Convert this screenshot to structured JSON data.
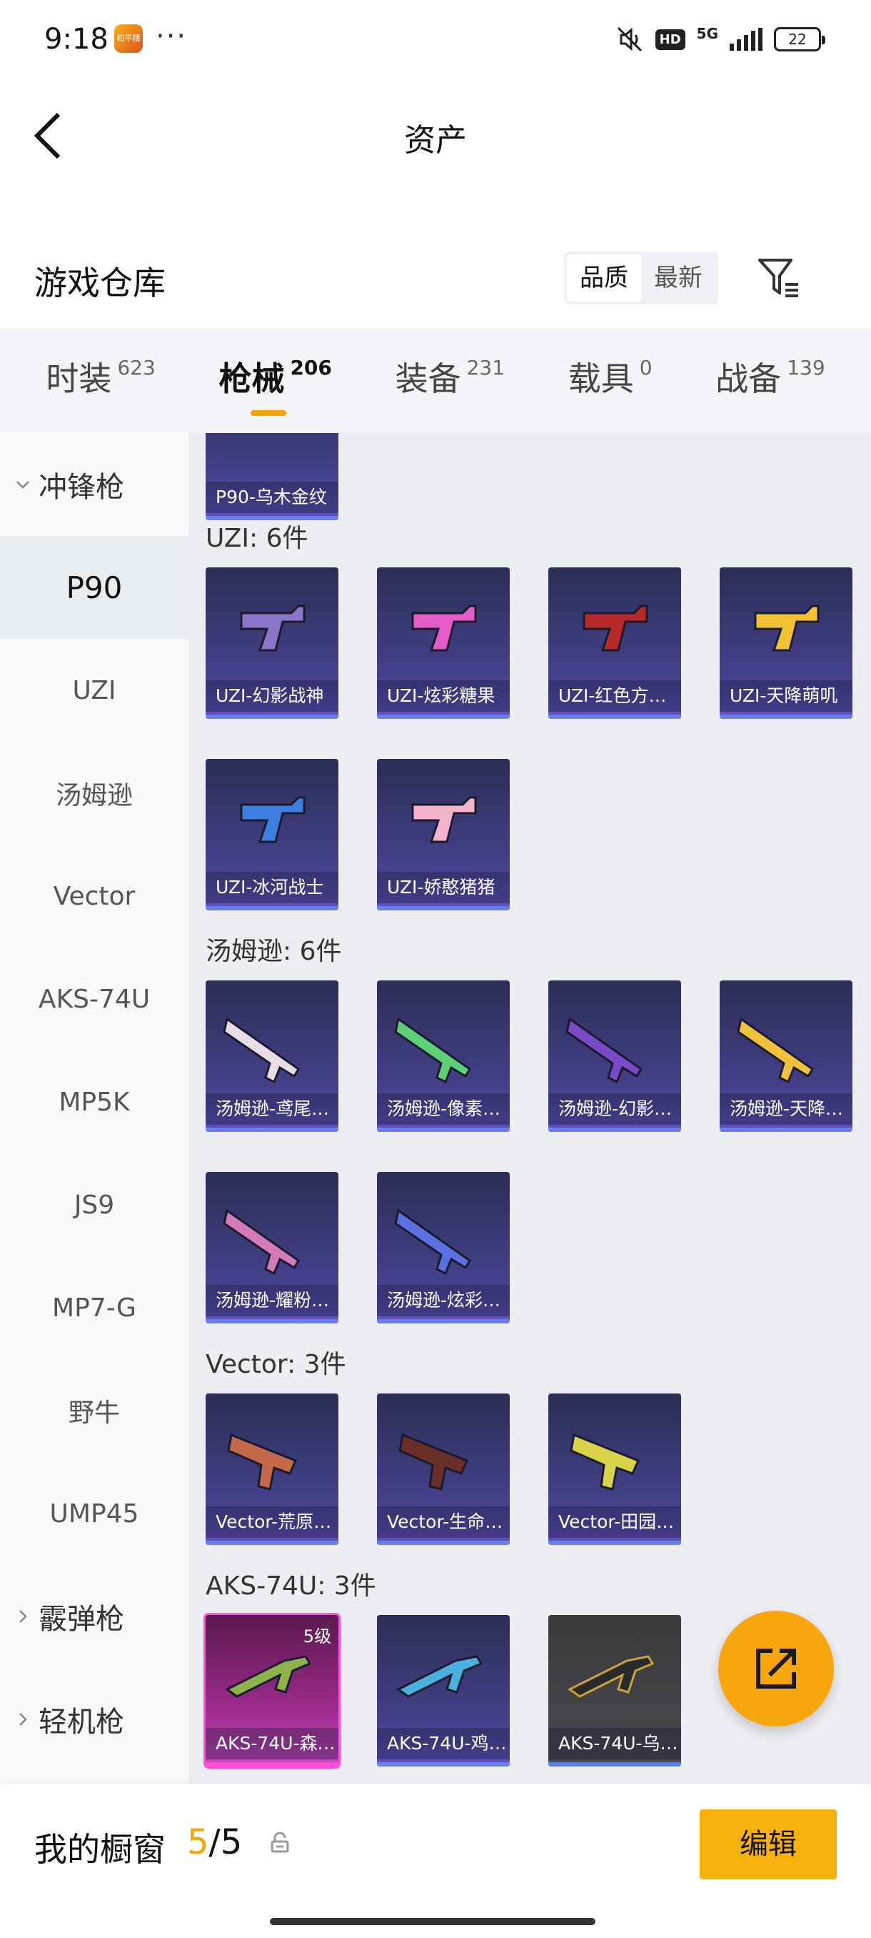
{
  "status_bar": {
    "time": "9:18",
    "app_icon_text": "和平精英",
    "dots": "···",
    "hd": "HD",
    "network": "5G",
    "battery": "22"
  },
  "header": {
    "title": "资产"
  },
  "warehouse": {
    "title": "游戏仓库",
    "sort_options": [
      "品质",
      "最新"
    ],
    "active_sort": "品质"
  },
  "tabs": [
    {
      "label": "时装",
      "count": "623"
    },
    {
      "label": "枪械",
      "count": "206"
    },
    {
      "label": "装备",
      "count": "231"
    },
    {
      "label": "载具",
      "count": "0"
    },
    {
      "label": "战备",
      "count": "139"
    }
  ],
  "sidebar": {
    "groups": {
      "smg": "冲锋枪",
      "shotgun": "霰弹枪",
      "lmg": "轻机枪"
    },
    "items": [
      "P90",
      "UZI",
      "汤姆逊",
      "Vector",
      "AKS-74U",
      "MP5K",
      "JS9",
      "MP7-G",
      "野牛",
      "UMP45"
    ]
  },
  "content": {
    "top_card_label": "P90-乌木金纹",
    "sections": [
      {
        "title": "UZI: 6件",
        "cards": [
          "UZI-幻影战神",
          "UZI-炫彩糖果",
          "UZI-红色方…",
          "UZI-天降萌叽",
          "UZI-冰河战士",
          "UZI-娇憨猪猪"
        ]
      },
      {
        "title": "汤姆逊: 6件",
        "cards": [
          "汤姆逊-鸢尾…",
          "汤姆逊-像素…",
          "汤姆逊-幻影…",
          "汤姆逊-天降…",
          "汤姆逊-耀粉…",
          "汤姆逊-炫彩…"
        ]
      },
      {
        "title": "Vector: 3件",
        "cards": [
          "Vector-荒原…",
          "Vector-生命…",
          "Vector-田园…"
        ]
      },
      {
        "title": "AKS-74U: 3件",
        "cards": [
          "AKS-74U-森…",
          "AKS-74U-鸡…",
          "AKS-74U-乌…"
        ]
      }
    ],
    "aks_first_level": "5级"
  },
  "bottom_bar": {
    "title": "我的橱窗",
    "count_current": "5",
    "count_total": "/5",
    "edit_label": "编辑"
  },
  "colors": {
    "accent": "#f5a400",
    "card_purple": "#45408a",
    "card_pink": "#ff4fd8"
  }
}
